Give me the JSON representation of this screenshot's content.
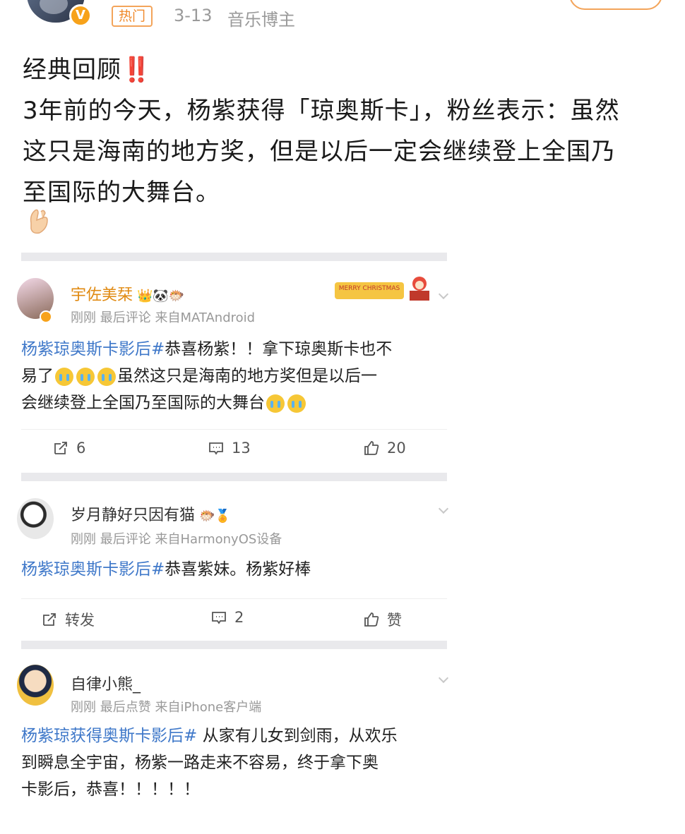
{
  "header": {
    "hot_tag": "热门",
    "date": "3-13",
    "role": "音乐博主"
  },
  "post": {
    "lines": [
      "经典回顾",
      "3年前的今天，杨紫获得「琼奥斯卡」，粉丝表示：虽然",
      "这只是海南的地方奖，但是以后一定会继续登上全国乃",
      "至国际的大舞台。"
    ],
    "bang": "‼️"
  },
  "comments": [
    {
      "name": "宇佐美栞",
      "meta": "刚刚 最后评论 来自MATAndroid",
      "topic": "杨紫琼奥斯卡影后#",
      "body_lines": [
        "恭喜杨紫！！拿下琼奥斯卡也不",
        "易了",
        "虽然这只是海南的地方奖但是以后一",
        "会继续登上全国乃至国际的大舞台"
      ],
      "reposts": "6",
      "comments": "13",
      "likes": "20",
      "banner": "MERRY CHRISTMAS"
    },
    {
      "name": "岁月静好只因有猫",
      "meta": "刚刚 最后评论 来自HarmonyOS设备",
      "topic": "杨紫琼奥斯卡影后#",
      "body": "恭喜紫妹。杨紫好棒",
      "reposts": "转发",
      "comments": "2",
      "likes": "赞"
    },
    {
      "name": "自律小熊_",
      "meta": "刚刚 最后点赞 来自iPhone客户端",
      "topic": "杨紫琼获得奥斯卡影后#",
      "body_lines": [
        " 从家有儿女到剑雨，从欢乐",
        "到瞬息全宇宙，杨紫一路走来不容易，终于拿下奥",
        "卡影后，恭喜！！！！！"
      ]
    }
  ],
  "colors": {
    "topic": "#3f78c9",
    "accent": "#f08a2c",
    "meta": "#999999"
  }
}
